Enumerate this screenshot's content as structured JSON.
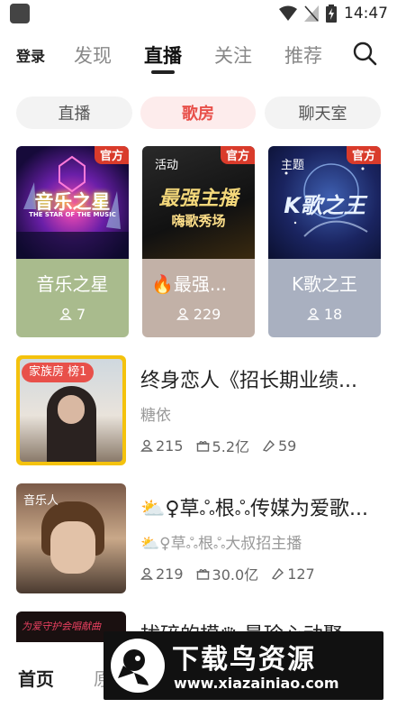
{
  "status_bar": {
    "time": "14:47"
  },
  "top_nav": {
    "login": "登录",
    "tabs": [
      {
        "label": "发现"
      },
      {
        "label": "直播"
      },
      {
        "label": "关注"
      },
      {
        "label": "推荐"
      }
    ],
    "active_tab": "直播"
  },
  "chips": [
    {
      "label": "直播"
    },
    {
      "label": "歌房"
    },
    {
      "label": "聊天室"
    }
  ],
  "active_chip": "歌房",
  "cards": [
    {
      "name": "音乐之星",
      "count": "7",
      "badge": "官方",
      "cover_title": "音乐之星",
      "cover_sub": "THE STAR OF THE MUSIC",
      "bottom_color": "#a9bb8d"
    },
    {
      "name": "🔥最强...",
      "count": "229",
      "badge": "官方",
      "tag": "活动",
      "cover_title": "最强主播",
      "cover_sub": "嗨歌秀场",
      "bottom_color": "#c2b1a7"
    },
    {
      "name": "K歌之王",
      "count": "18",
      "badge": "官方",
      "tag": "主题",
      "cover_title": "K歌之王",
      "bottom_color": "#a9b0c0"
    }
  ],
  "rows": [
    {
      "title": "终身恋人《招长期业绩...",
      "sub": "糖依",
      "badge": "家族房 榜1",
      "viewers": "215",
      "gifts": "5.2亿",
      "likes": "59"
    },
    {
      "title": "⛅♀草ஃ根ஃ传媒为爱歌...",
      "sub": "⛅♀草ஃ根ஃ大叔招主播",
      "badge": "音乐人",
      "viewers": "219",
      "gifts": "30.0亿",
      "likes": "127"
    },
    {
      "title": "扰碎的模♛ 最珍心动聚",
      "sub": "",
      "badge": "",
      "thumb_text": "为爱守护会唱献曲"
    }
  ],
  "bottom_nav": {
    "home": "首页",
    "second": "原"
  },
  "watermark": {
    "title": "下载鸟资源",
    "url": "www.xiazainiao.com"
  },
  "colors": {
    "accent": "#e8504a",
    "official": "#d93b2b"
  }
}
